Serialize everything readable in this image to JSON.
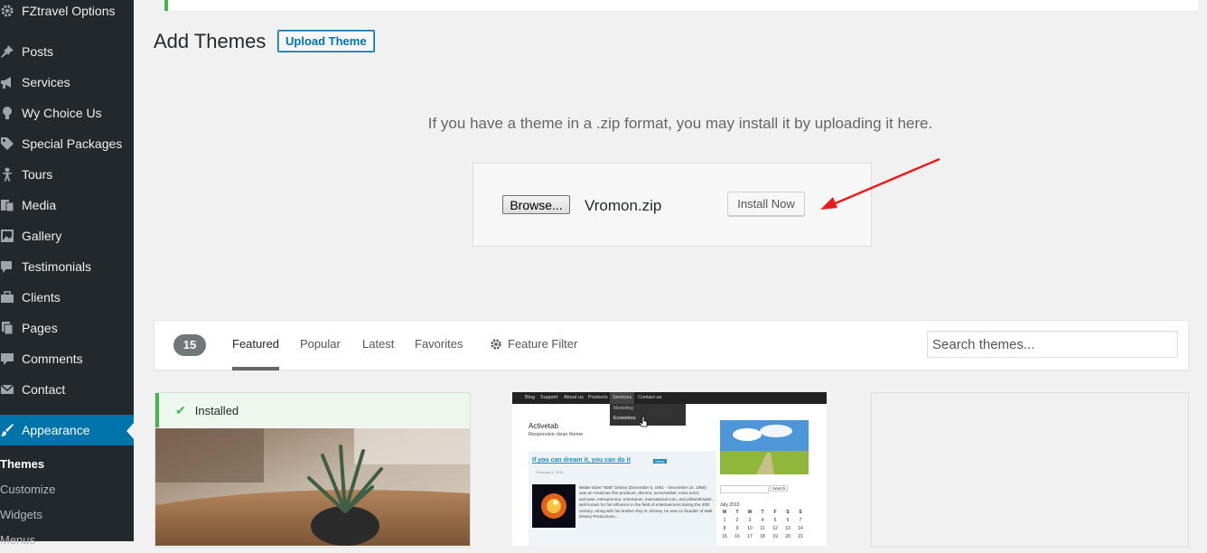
{
  "sidebar": {
    "items": [
      {
        "label": "FZtravel Options",
        "icon": "gear-icon"
      },
      {
        "label": "Posts",
        "icon": "pin-icon"
      },
      {
        "label": "Services",
        "icon": "megaphone-icon"
      },
      {
        "label": "Wy Choice Us",
        "icon": "lightbulb-icon"
      },
      {
        "label": "Special Packages",
        "icon": "tag-icon"
      },
      {
        "label": "Tours",
        "icon": "person-icon"
      },
      {
        "label": "Media",
        "icon": "media-icon"
      },
      {
        "label": "Gallery",
        "icon": "gallery-icon"
      },
      {
        "label": "Testimonials",
        "icon": "testimonial-icon"
      },
      {
        "label": "Clients",
        "icon": "briefcase-icon"
      },
      {
        "label": "Pages",
        "icon": "pages-icon"
      },
      {
        "label": "Comments",
        "icon": "comment-icon"
      },
      {
        "label": "Contact",
        "icon": "mail-icon"
      },
      {
        "label": "Appearance",
        "icon": "brush-icon"
      }
    ],
    "submenu": [
      "Themes",
      "Customize",
      "Widgets",
      "Menus"
    ]
  },
  "header": {
    "title": "Add Themes",
    "upload_button": "Upload Theme"
  },
  "upload": {
    "description": "If you have a theme in a .zip format, you may install it by uploading it here.",
    "browse_label": "Browse...",
    "file_name": "Vromon.zip",
    "install_label": "Install Now"
  },
  "filter": {
    "count": "15",
    "tabs": [
      "Featured",
      "Popular",
      "Latest",
      "Favorites"
    ],
    "feature_filter": "Feature Filter",
    "search_placeholder": "Search themes..."
  },
  "cards": {
    "installed_label": "Installed",
    "preview": {
      "nav": [
        "Blog",
        "Support",
        "About us",
        "Products",
        "Services",
        "Contact us"
      ],
      "dropdown": [
        "Marketing",
        "Economics"
      ],
      "site_title": "Activetab",
      "tagline": "Responsive clean theme",
      "post_title": "If you can dream it, you can do it",
      "post_tag": "Sticky",
      "post_meta": "February 4, 2013",
      "post_excerpt": "Walter Elias \"Walt\" Disney (December 5, 1901 – December 15, 1966) was an American film producer, director, screenwriter, voice actor, animator, entrepreneur, entertainer, international icon, and philanthropist, well known for his influence in the field of entertainment during the 20th century. Along with his brother Roy O. Disney, he was co-founder of Walt Disney Productions,...",
      "search_label": "Search",
      "calendar_title": "July 2013",
      "calendar_days": [
        "M",
        "T",
        "W",
        "T",
        "F",
        "S",
        "S"
      ],
      "calendar_rows": [
        [
          "1",
          "2",
          "3",
          "4",
          "5",
          "6",
          "7"
        ],
        [
          "8",
          "9",
          "10",
          "11",
          "12",
          "13",
          "14"
        ],
        [
          "15",
          "16",
          "17",
          "18",
          "19",
          "20",
          "21"
        ]
      ]
    }
  },
  "colors": {
    "sidebar_bg": "#23282d",
    "active_bg": "#0073aa",
    "installed_green": "#46b450",
    "annotation_arrow": "#e81c1c"
  }
}
